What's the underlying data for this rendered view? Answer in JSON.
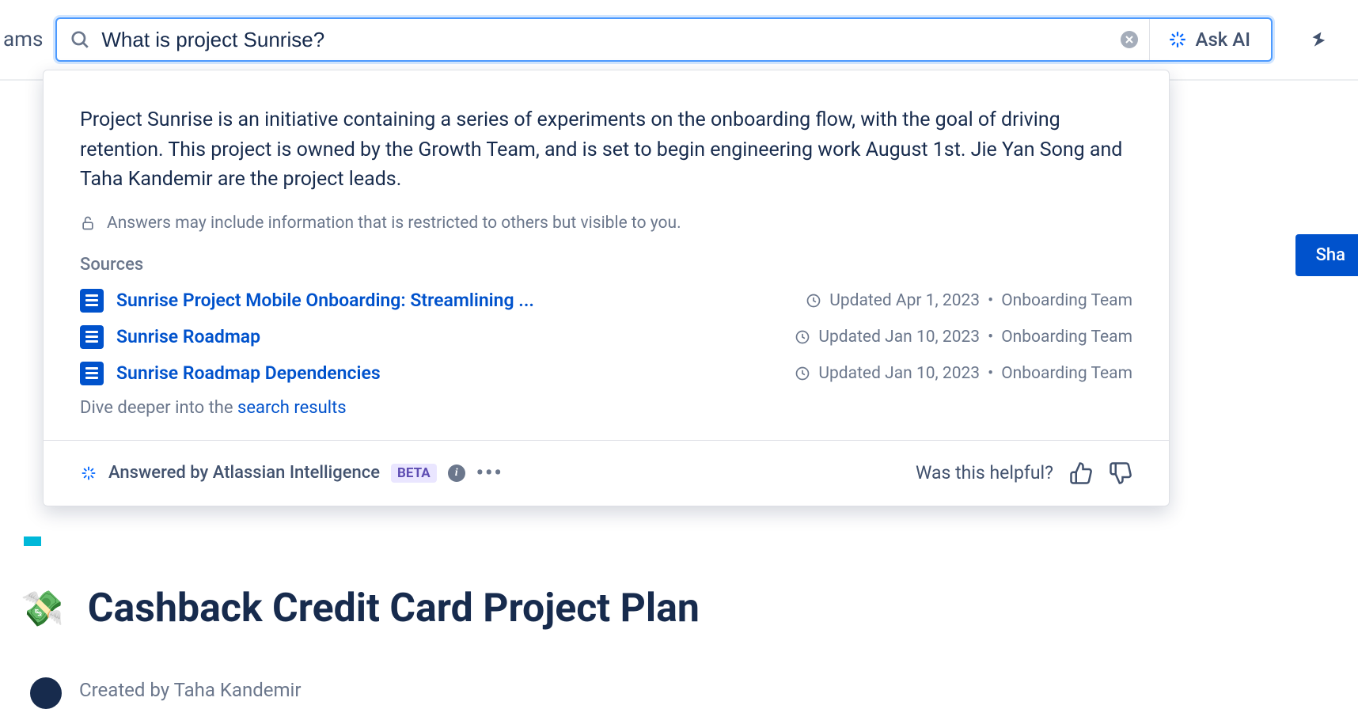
{
  "nav": {
    "item_fragment": "ams"
  },
  "search": {
    "query": "What is project Sunrise?",
    "ask_ai_label": "Ask AI"
  },
  "answer": {
    "text": "Project Sunrise is an initiative containing a series of experiments on the onboarding flow, with the goal of driving retention. This project is owned by the Growth Team, and is set to begin engineering work August 1st. Jie Yan Song and Taha Kandemir are the project leads.",
    "restricted_notice": "Answers may include information that is restricted to others but visible to you."
  },
  "sources": {
    "heading": "Sources",
    "items": [
      {
        "title": "Sunrise Project Mobile Onboarding: Streamlining ...",
        "updated": "Updated Apr 1, 2023",
        "space": "Onboarding Team"
      },
      {
        "title": "Sunrise Roadmap",
        "updated": "Updated Jan 10, 2023",
        "space": "Onboarding Team"
      },
      {
        "title": "Sunrise Roadmap Dependencies",
        "updated": "Updated Jan 10, 2023",
        "space": "Onboarding Team"
      }
    ],
    "dive_prefix": "Dive deeper into the ",
    "dive_link": "search results"
  },
  "footer": {
    "answered_by": "Answered by Atlassian Intelligence",
    "beta": "BETA",
    "helpful_prompt": "Was this helpful?"
  },
  "background": {
    "share_label": "Sha",
    "title": "Cashback Credit Card Project Plan",
    "byline": "Created by Taha Kandemir"
  }
}
